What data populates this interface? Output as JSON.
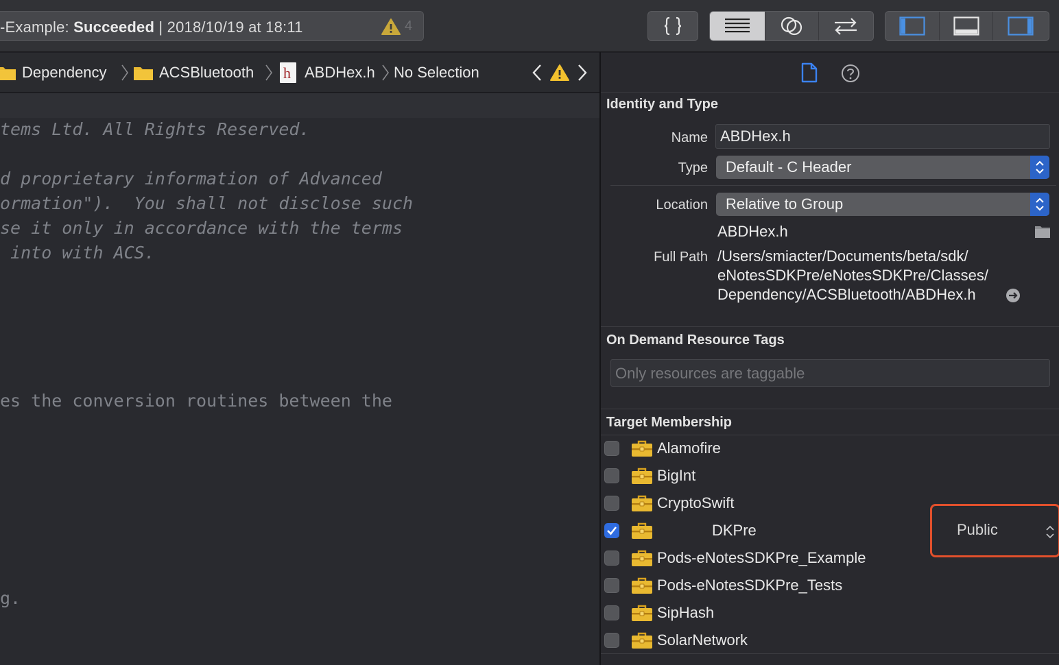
{
  "toolbar": {
    "status": {
      "scheme": "-Example: ",
      "result": "Succeeded",
      "separator": " | ",
      "timestamp": "2018/10/19 at 18:11",
      "warning_count": "4"
    },
    "buttons": [
      "braces-icon",
      "standard-editor-icon",
      "assistant-editor-icon",
      "version-editor-icon",
      "navigator-toggle-icon",
      "debug-area-toggle-icon",
      "utilities-toggle-icon"
    ]
  },
  "jumpbar": {
    "items": [
      "Dependency",
      "ACSBluetooth",
      "ABDHex.h",
      "No Selection"
    ],
    "file_badge": "h"
  },
  "editor": {
    "lines": [
      "tems Ltd. All Rights Reserved.",
      "d proprietary information of Advanced",
      "ormation\").  You shall not disclose such",
      "se it only in accordance with the terms",
      " into with ACS.",
      "es the conversion routines between the",
      "g."
    ]
  },
  "inspector": {
    "identity": {
      "title": "Identity and Type",
      "name_label": "Name",
      "name_value": "ABDHex.h",
      "type_label": "Type",
      "type_value": "Default - C Header",
      "location_label": "Location",
      "location_value": "Relative to Group",
      "location_file": "ABDHex.h",
      "fullpath_label": "Full Path",
      "fullpath_lines": [
        "/Users/smiacter/Documents/beta/sdk/",
        "eNotesSDKPre/eNotesSDKPre/Classes/",
        "Dependency/ACSBluetooth/ABDHex.h"
      ]
    },
    "odr": {
      "title": "On Demand Resource Tags",
      "placeholder": "Only resources are taggable"
    },
    "target_membership": {
      "title": "Target Membership",
      "targets": [
        {
          "name": "Alamofire",
          "checked": false
        },
        {
          "name": "BigInt",
          "checked": false
        },
        {
          "name": "CryptoSwift",
          "checked": false
        },
        {
          "name": "DKPre",
          "checked": true
        },
        {
          "name": "Pods-eNotesSDKPre_Example",
          "checked": false
        },
        {
          "name": "Pods-eNotesSDKPre_Tests",
          "checked": false
        },
        {
          "name": "SipHash",
          "checked": false
        },
        {
          "name": "SolarNetwork",
          "checked": false
        }
      ],
      "visibility": "Public"
    },
    "colors": {
      "accent": "#2f6ce0",
      "highlight_box": "#e2502c",
      "folder": "#e9b931"
    }
  }
}
